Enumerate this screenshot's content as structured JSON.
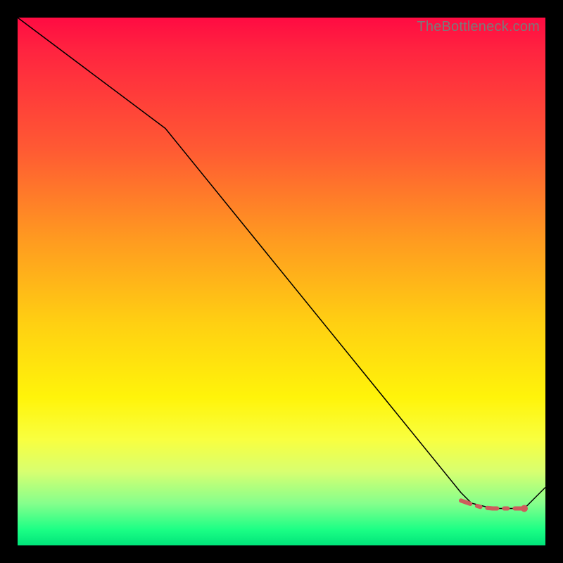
{
  "watermark": "TheBottleneck.com",
  "chart_data": {
    "type": "line",
    "title": "",
    "xlabel": "",
    "ylabel": "",
    "xlim": [
      0,
      100
    ],
    "ylim": [
      0,
      100
    ],
    "grid": false,
    "series": [
      {
        "name": "curve",
        "x": [
          0,
          28,
          84,
          86,
          90,
          94,
          96,
          100
        ],
        "values": [
          100,
          79,
          10,
          8,
          7,
          7,
          7,
          11
        ]
      }
    ],
    "annotations": [
      {
        "name": "valley-dash",
        "x": [
          84,
          86,
          88,
          90,
          92,
          94,
          96
        ],
        "values": [
          8.5,
          7.8,
          7.2,
          7.0,
          7.0,
          7.0,
          7.0
        ]
      },
      {
        "name": "valley-dot",
        "x": 96,
        "value": 7.0
      }
    ]
  }
}
